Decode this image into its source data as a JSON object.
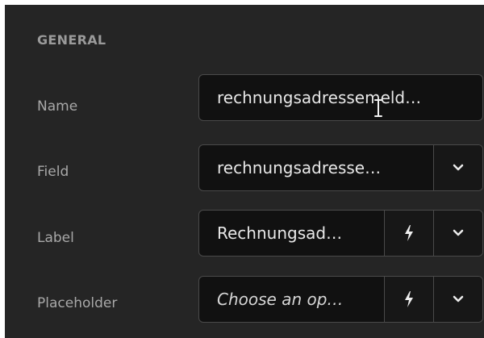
{
  "section": {
    "title": "GENERAL"
  },
  "fields": {
    "name": {
      "label": "Name",
      "value": "rechnungsadressemeld…"
    },
    "field": {
      "label": "Field",
      "value": "rechnungsadresse…",
      "dropdown_icon": "chevron-down-icon"
    },
    "label_field": {
      "label": "Label",
      "value": "Rechnungsad…",
      "action_icon": "lightning-icon",
      "dropdown_icon": "chevron-down-icon"
    },
    "placeholder": {
      "label": "Placeholder",
      "value": "Choose an op…",
      "action_icon": "lightning-icon",
      "dropdown_icon": "chevron-down-icon"
    }
  },
  "colors": {
    "panel_bg": "#252525",
    "input_bg": "#111111",
    "border": "#4a4a4a",
    "label_text": "#a8a8a8",
    "value_text": "#e8e8e8"
  }
}
